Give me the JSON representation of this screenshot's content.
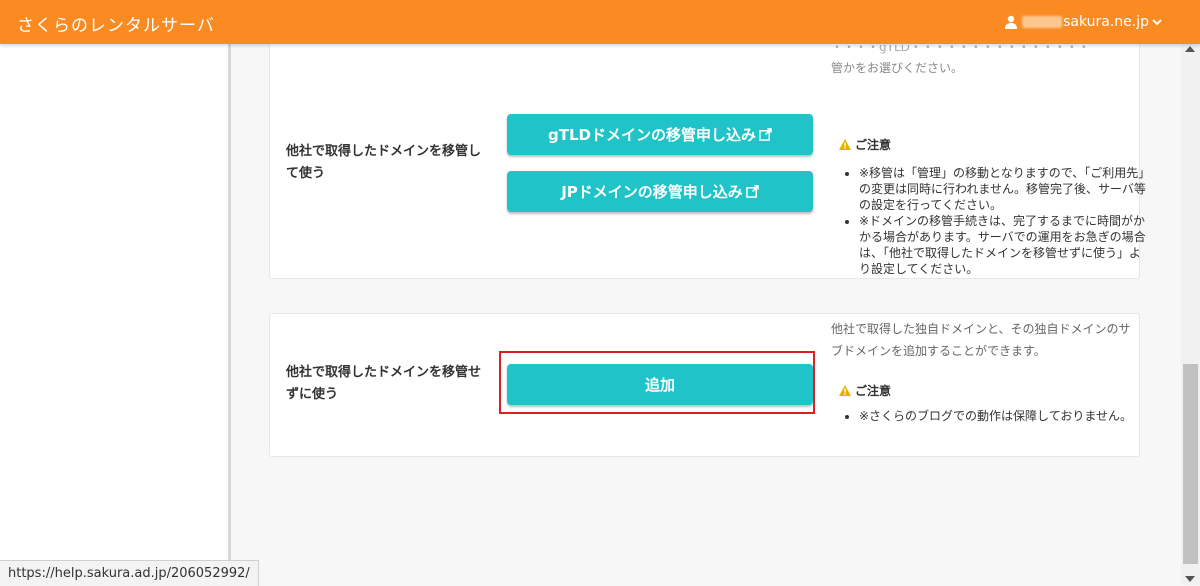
{
  "header": {
    "app_title": "さくらのレンタルサーバ",
    "user_domain": "sakura.ne.jp",
    "accent_color": "#fa8b23"
  },
  "card1": {
    "partial_text": "・・・ gTLD ・・・ 管かをお選びください。",
    "desc_visible": "管かをお選びください。",
    "label": "他社で取得したドメインを移管して使う",
    "buttons": {
      "gtld": "gTLDドメインの移管申し込み",
      "jp": "JPドメインの移管申し込み"
    },
    "warning_title": "ご注意",
    "notes": [
      "※移管は「管理」の移動となりますので、「ご利用先」の変更は同時に行われません。移管完了後、サーバ等の設定を行ってください。",
      "※ドメインの移管手続きは、完了するまでに時間がかかる場合があります。サーバでの運用をお急ぎの場合は、「他社で取得したドメインを移管せずに使う」より設定してください。"
    ]
  },
  "card2": {
    "label": "他社で取得したドメインを移管せずに使う",
    "button": "追加",
    "description": "他社で取得した独自ドメインと、その独自ドメインのサブドメインを追加することができます。",
    "warning_title": "ご注意",
    "notes": [
      "※さくらのブログでの動作は保障しておりません。"
    ]
  },
  "statusbar": {
    "url": "https://help.sakura.ad.jp/206052992/"
  },
  "icons": {
    "user": "user-icon",
    "chevron": "chevron-down-icon",
    "external": "external-link-icon",
    "warning": "warning-icon"
  },
  "colors": {
    "button": "#20c3c8",
    "highlight": "#e02020"
  }
}
